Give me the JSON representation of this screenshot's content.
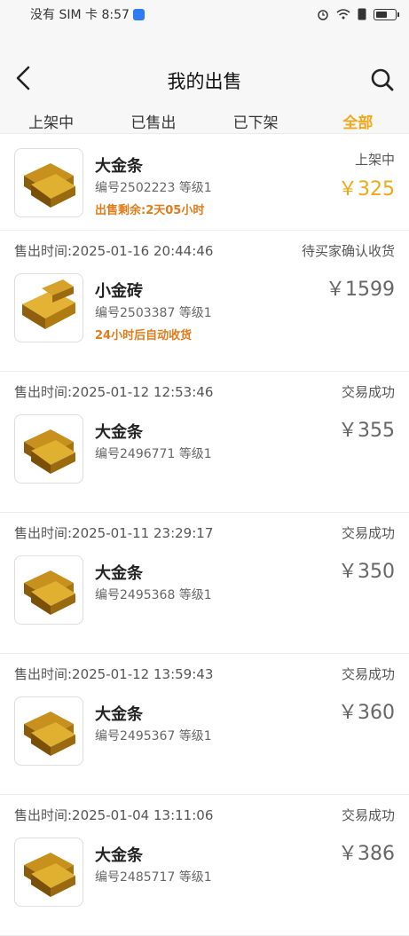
{
  "status_bar": {
    "carrier_time": "没有 SIM 卡 8:57"
  },
  "header": {
    "title": "我的出售"
  },
  "tabs": [
    {
      "label": "上架中"
    },
    {
      "label": "已售出"
    },
    {
      "label": "已下架"
    },
    {
      "label": "全部"
    }
  ],
  "active_tab_color": "#f0a818",
  "orders": [
    {
      "name": "大金条",
      "meta": "编号2502223 等级1",
      "note": "出售剩余:2天05小时",
      "status": "上架中",
      "price": "￥325"
    },
    {
      "time": "售出时间:2025-01-16 20:44:46",
      "status": "待买家确认收货",
      "name": "小金砖",
      "meta": "编号2503387 等级1",
      "note": "24小时后自动收货",
      "price": "￥1599"
    },
    {
      "time": "售出时间:2025-01-12 12:53:46",
      "status": "交易成功",
      "name": "大金条",
      "meta": "编号2496771 等级1",
      "price": "￥355"
    },
    {
      "time": "售出时间:2025-01-11 23:29:17",
      "status": "交易成功",
      "name": "大金条",
      "meta": "编号2495368 等级1",
      "price": "￥350"
    },
    {
      "time": "售出时间:2025-01-12 13:59:43",
      "status": "交易成功",
      "name": "大金条",
      "meta": "编号2495367 等级1",
      "price": "￥360"
    },
    {
      "time": "售出时间:2025-01-04 13:11:06",
      "status": "交易成功",
      "name": "大金条",
      "meta": "编号2485717 等级1",
      "price": "￥386"
    }
  ]
}
